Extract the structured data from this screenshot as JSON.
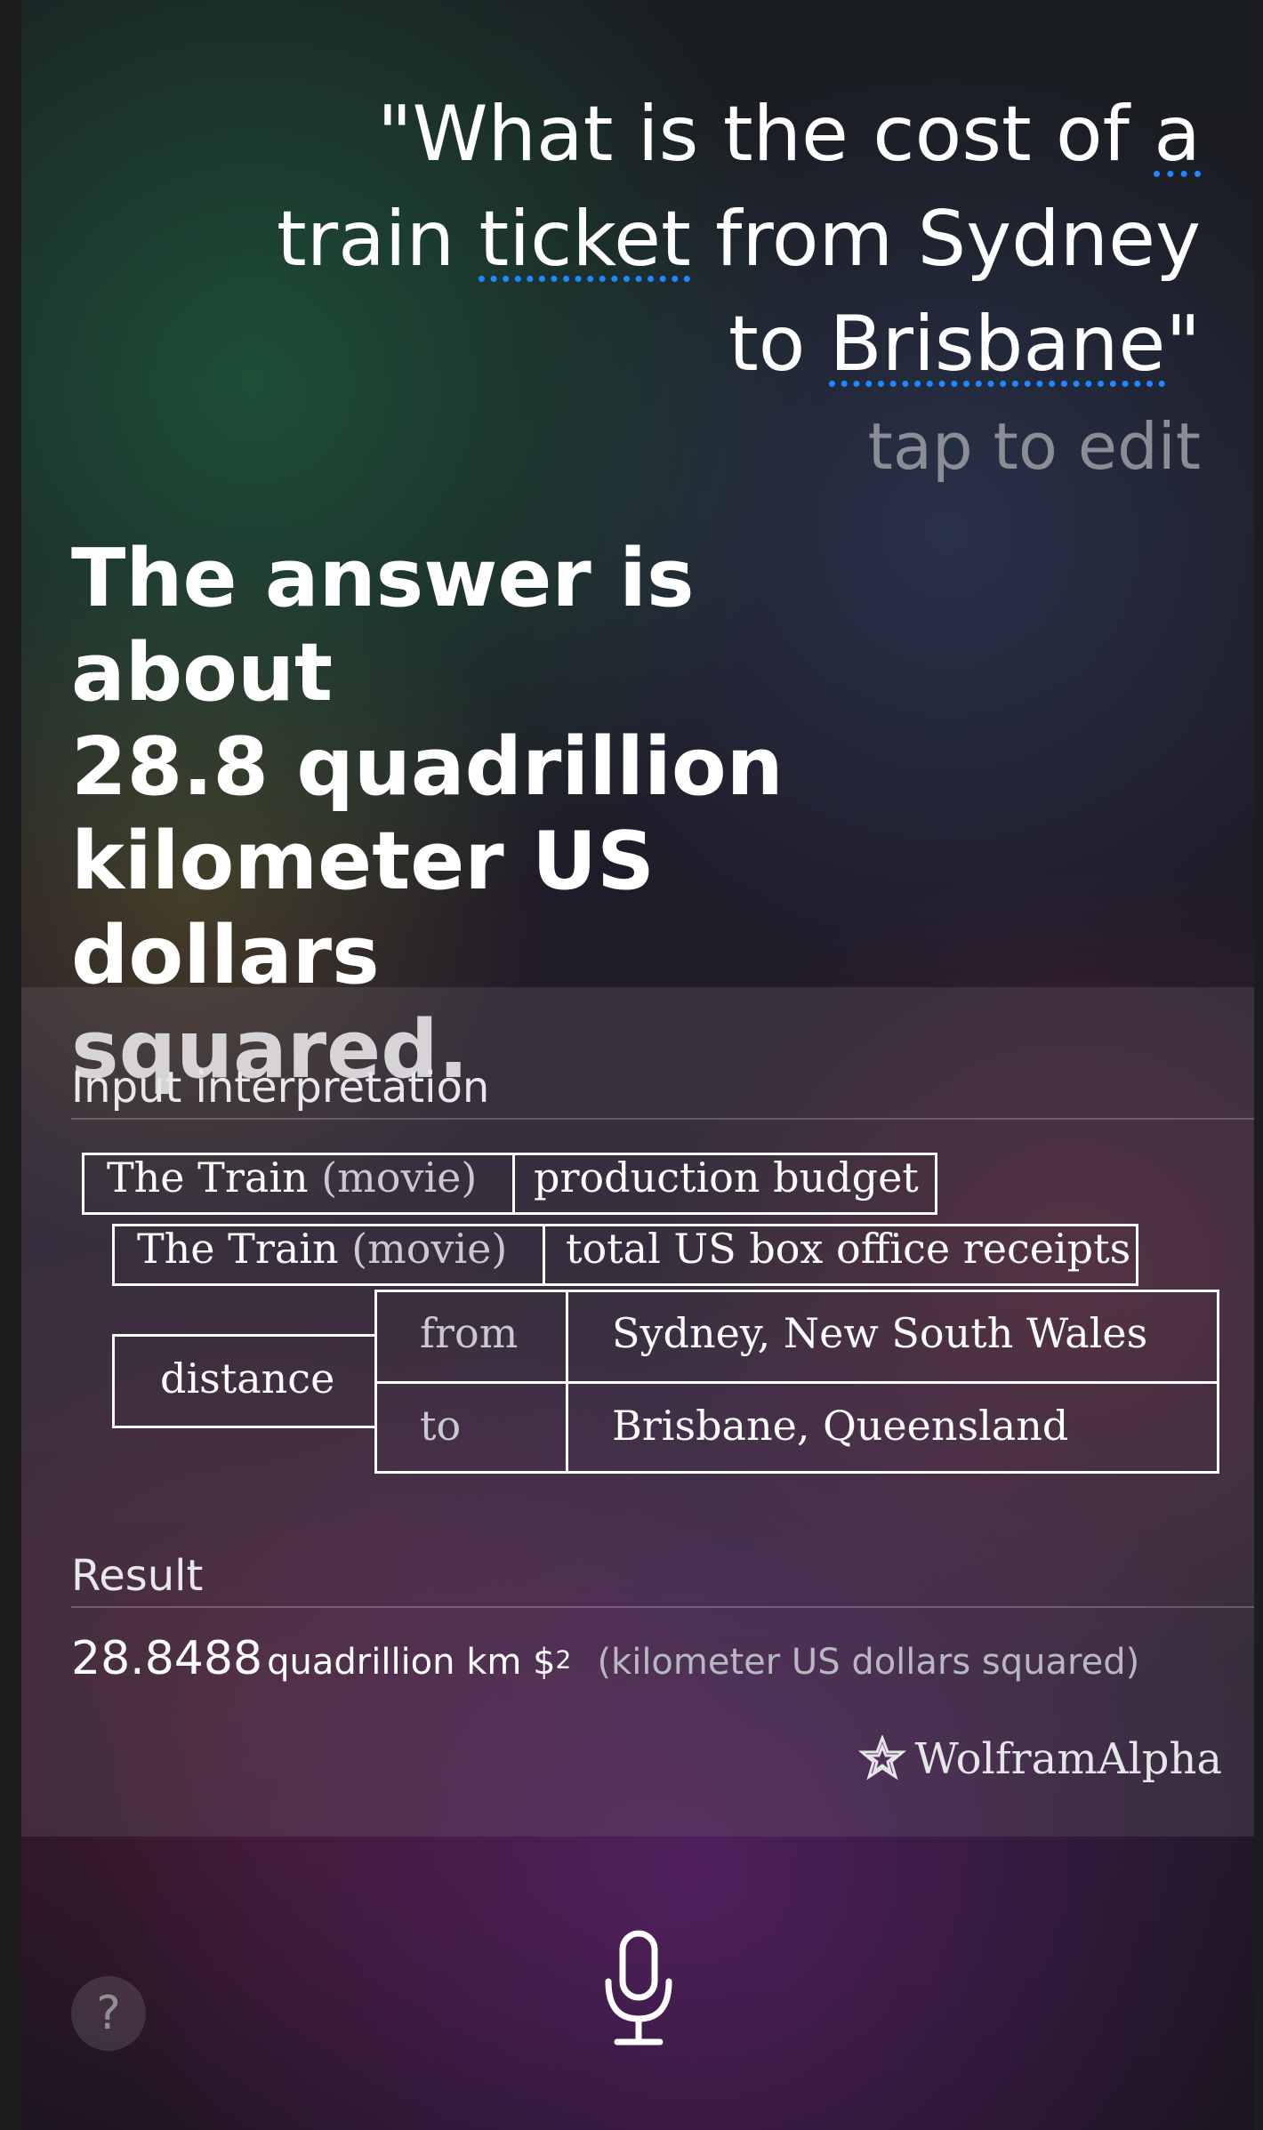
{
  "query": {
    "line1_pre": "\"What is the cost of ",
    "line1_link": "a",
    "line2_pre": "train ",
    "line2_link": "ticket",
    "line2_post": " from Sydney",
    "line3_pre": "to ",
    "line3_link": "Brisbane",
    "line3_post": "\"",
    "edit_hint": "tap to edit"
  },
  "answer": {
    "line1": "The answer is about",
    "line2": "28.8 quadrillion",
    "line3": "kilometer US dollars",
    "line4": "squared."
  },
  "card": {
    "input_title": "Input interpretation",
    "row1": {
      "name": "The Train",
      "qualifier": "(movie)",
      "property": "production budget"
    },
    "row2": {
      "name": "The Train",
      "qualifier": "(movie)",
      "property": "total US box office receipts"
    },
    "distance": {
      "label": "distance",
      "from_label": "from",
      "from_value": "Sydney, New South Wales",
      "to_label": "to",
      "to_value": "Brisbane, Queensland"
    },
    "result_title": "Result",
    "result": {
      "value": "28.8488",
      "unit": "quadrillion km $",
      "exponent": "2",
      "description": "(kilometer US dollars squared)"
    },
    "brand": "WolframAlpha"
  },
  "controls": {
    "help": "?",
    "mic_icon": "microphone-icon"
  }
}
